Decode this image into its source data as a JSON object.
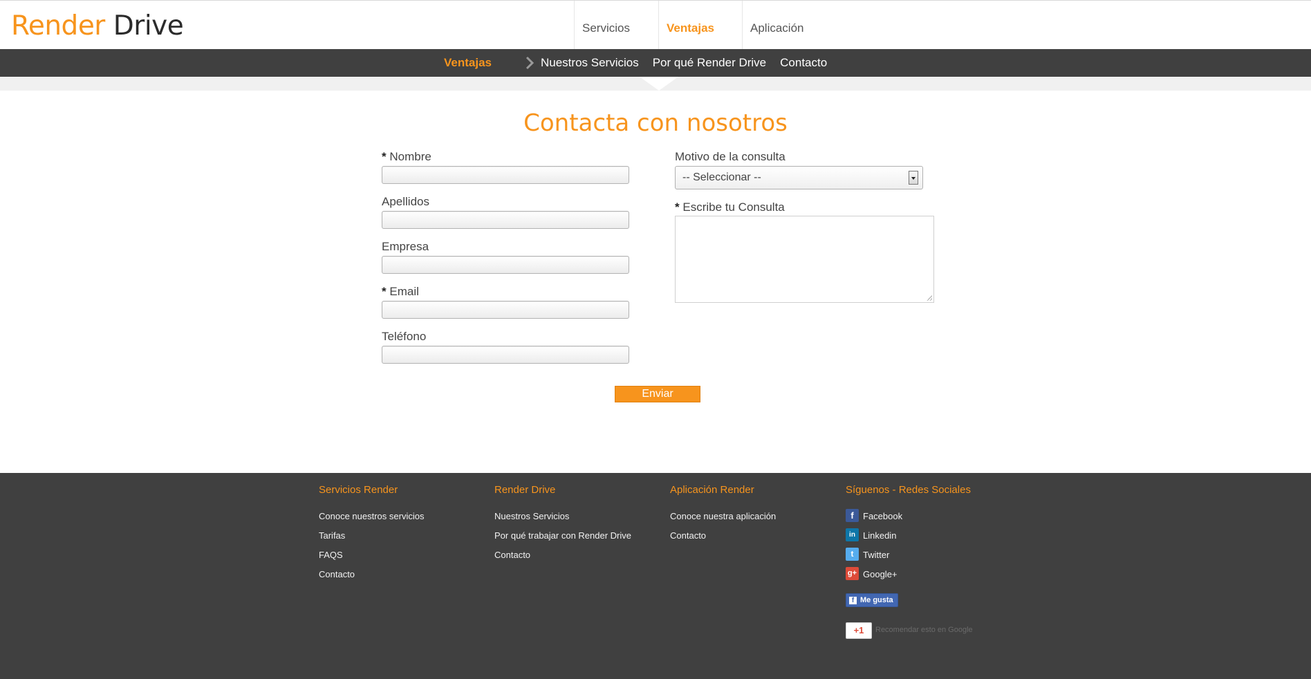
{
  "logo": {
    "part1": "Render",
    "part2": "Drive"
  },
  "top_nav": {
    "items": [
      "Servicios",
      "Ventajas",
      "Aplicación"
    ],
    "selected": "Ventajas"
  },
  "sub_nav": {
    "current": "Ventajas",
    "links": [
      "Nuestros Servicios",
      "Por qué Render Drive",
      "Contacto"
    ]
  },
  "form": {
    "title": "Contacta con nosotros",
    "required_mark": "*",
    "fields": {
      "nombre": {
        "label": "Nombre",
        "value": ""
      },
      "apellidos": {
        "label": "Apellidos",
        "value": ""
      },
      "empresa": {
        "label": "Empresa",
        "value": ""
      },
      "email": {
        "label": "Email",
        "value": ""
      },
      "telefono": {
        "label": "Teléfono",
        "value": ""
      }
    },
    "motivo": {
      "label": "Motivo de la consulta",
      "selected": "-- Seleccionar --"
    },
    "consulta": {
      "label": "Escribe tu Consulta",
      "value": ""
    },
    "submit_label": "Enviar"
  },
  "footer": {
    "columns": [
      {
        "heading": "Servicios Render",
        "links": [
          "Conoce nuestros servicios",
          "Tarifas",
          "FAQS",
          "Contacto"
        ]
      },
      {
        "heading": "Render Drive",
        "links": [
          "Nuestros Servicios",
          "Por qué trabajar con Render Drive",
          "Contacto"
        ]
      },
      {
        "heading": "Aplicación Render",
        "links": [
          "Conoce nuestra aplicación",
          "Contacto"
        ]
      },
      {
        "heading": "Síguenos - Redes Sociales",
        "links": [
          "Facebook",
          "Linkedin",
          "Twitter",
          "Google+"
        ]
      }
    ],
    "social_icons": [
      "facebook-icon",
      "linkedin-icon",
      "twitter-icon",
      "google-plus-icon"
    ],
    "like_label": "Me gusta",
    "plusone_label": "+1",
    "recommend_text": "Recomendar esto en Google"
  },
  "colors": {
    "accent": "#f7941d",
    "dark_bar": "#404040"
  }
}
